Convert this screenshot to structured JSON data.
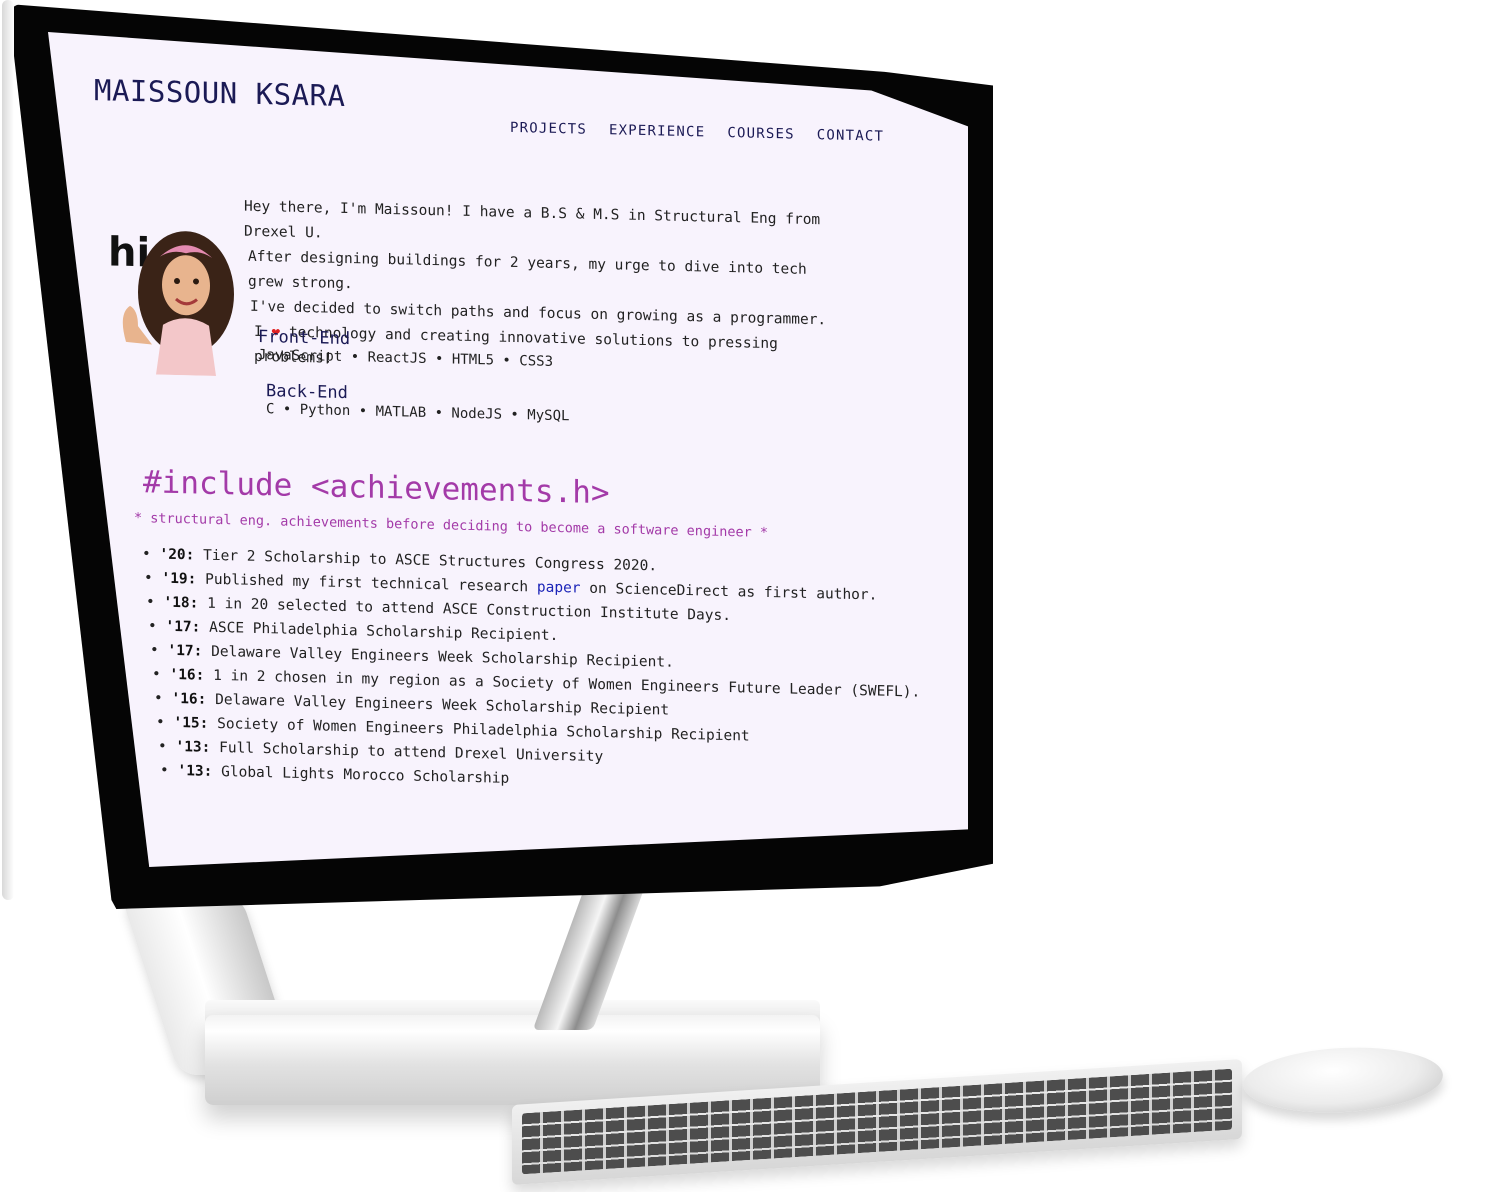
{
  "site": {
    "brand": "MAISSOUN KSARA",
    "nav": [
      "PROJECTS",
      "EXPERIENCE",
      "COURSES",
      "CONTACT"
    ],
    "avatar_text": "hi",
    "intro": [
      "Hey there, I'm Maissoun! I have a B.S & M.S in Structural Eng from Drexel U.",
      "After designing buildings for 2 years, my urge to dive into tech grew strong.",
      "I've decided to switch paths and focus on growing as a programmer."
    ],
    "intro_love_prefix": "I",
    "intro_love_suffix": "technology and creating innovative solutions to pressing problems!",
    "frontend": {
      "title": "Front-End",
      "items": "JavaScript • ReactJS • HTML5 • CSS3"
    },
    "backend": {
      "title": "Back-End",
      "items": "C • Python • MATLAB • NodeJS • MySQL"
    },
    "include_heading": "#include <achievements.h>",
    "include_sub": "* structural eng. achievements before deciding to become a software engineer *",
    "achievements": [
      {
        "year": "'20",
        "text": "Tier 2 Scholarship to ASCE Structures Congress 2020."
      },
      {
        "year": "'19",
        "text_before": "Published my first technical research",
        "link": "paper",
        "text_after": "on ScienceDirect as first author."
      },
      {
        "year": "'18",
        "text": "1 in 20 selected to attend ASCE Construction Institute Days."
      },
      {
        "year": "'17",
        "text": "ASCE Philadelphia Scholarship Recipient."
      },
      {
        "year": "'17",
        "text": "Delaware Valley Engineers Week Scholarship Recipient."
      },
      {
        "year": "'16",
        "text": "1 in 2 chosen in my region as a Society of Women Engineers Future Leader (SWEFL)."
      },
      {
        "year": "'16",
        "text": "Delaware Valley Engineers Week Scholarship Recipient"
      },
      {
        "year": "'15",
        "text": "Society of Women Engineers Philadelphia Scholarship Recipient"
      },
      {
        "year": "'13",
        "text": "Full Scholarship to attend Drexel University"
      },
      {
        "year": "'13",
        "text": "Global Lights Morocco Scholarship"
      }
    ]
  },
  "colors": {
    "screen_bg": "#f8f3fd",
    "brand": "#1b1a55",
    "accent_purple": "#a33aa8",
    "link_blue": "#1b24b8",
    "heart": "#e02020"
  }
}
